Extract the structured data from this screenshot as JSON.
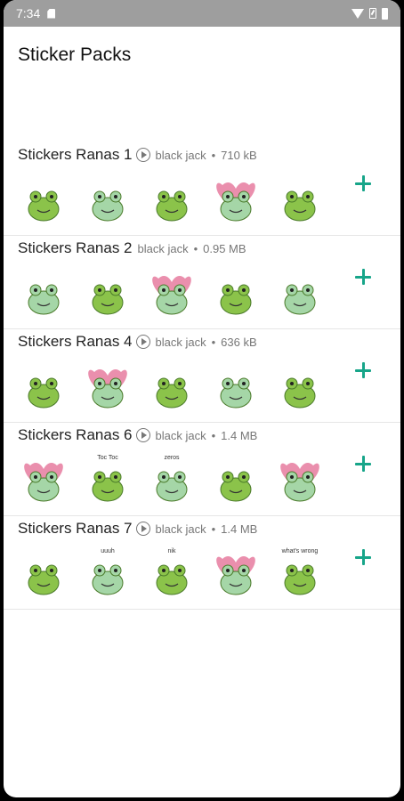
{
  "status": {
    "time": "7:34"
  },
  "header": {
    "title": "Sticker Packs"
  },
  "packs": [
    {
      "name": "Stickers Ranas 1",
      "has_preview": true,
      "author": "black jack",
      "size": "710 kB",
      "stickers": [
        {
          "caption": ""
        },
        {
          "caption": ""
        },
        {
          "caption": ""
        },
        {
          "caption": ""
        },
        {
          "caption": ""
        }
      ]
    },
    {
      "name": "Stickers Ranas 2",
      "has_preview": false,
      "author": "black jack",
      "size": "0.95 MB",
      "stickers": [
        {
          "caption": ""
        },
        {
          "caption": ""
        },
        {
          "caption": ""
        },
        {
          "caption": ""
        },
        {
          "caption": ""
        }
      ]
    },
    {
      "name": "Stickers Ranas 4",
      "has_preview": true,
      "author": "black jack",
      "size": "636 kB",
      "stickers": [
        {
          "caption": ""
        },
        {
          "caption": ""
        },
        {
          "caption": ""
        },
        {
          "caption": ""
        },
        {
          "caption": ""
        }
      ]
    },
    {
      "name": "Stickers Ranas 6",
      "has_preview": true,
      "author": "black jack",
      "size": "1.4 MB",
      "stickers": [
        {
          "caption": ""
        },
        {
          "caption": "Toc Toc"
        },
        {
          "caption": "zeros"
        },
        {
          "caption": ""
        },
        {
          "caption": ""
        }
      ]
    },
    {
      "name": "Stickers Ranas 7",
      "has_preview": true,
      "author": "black jack",
      "size": "1.4 MB",
      "stickers": [
        {
          "caption": ""
        },
        {
          "caption": "uuuh"
        },
        {
          "caption": "nik"
        },
        {
          "caption": ""
        },
        {
          "caption": "what's wrong"
        }
      ]
    }
  ],
  "colors": {
    "accent": "#17a589",
    "frog_green": "#8bc34a",
    "frog_light": "#a5d6a7",
    "heart_pink": "#e57399"
  }
}
